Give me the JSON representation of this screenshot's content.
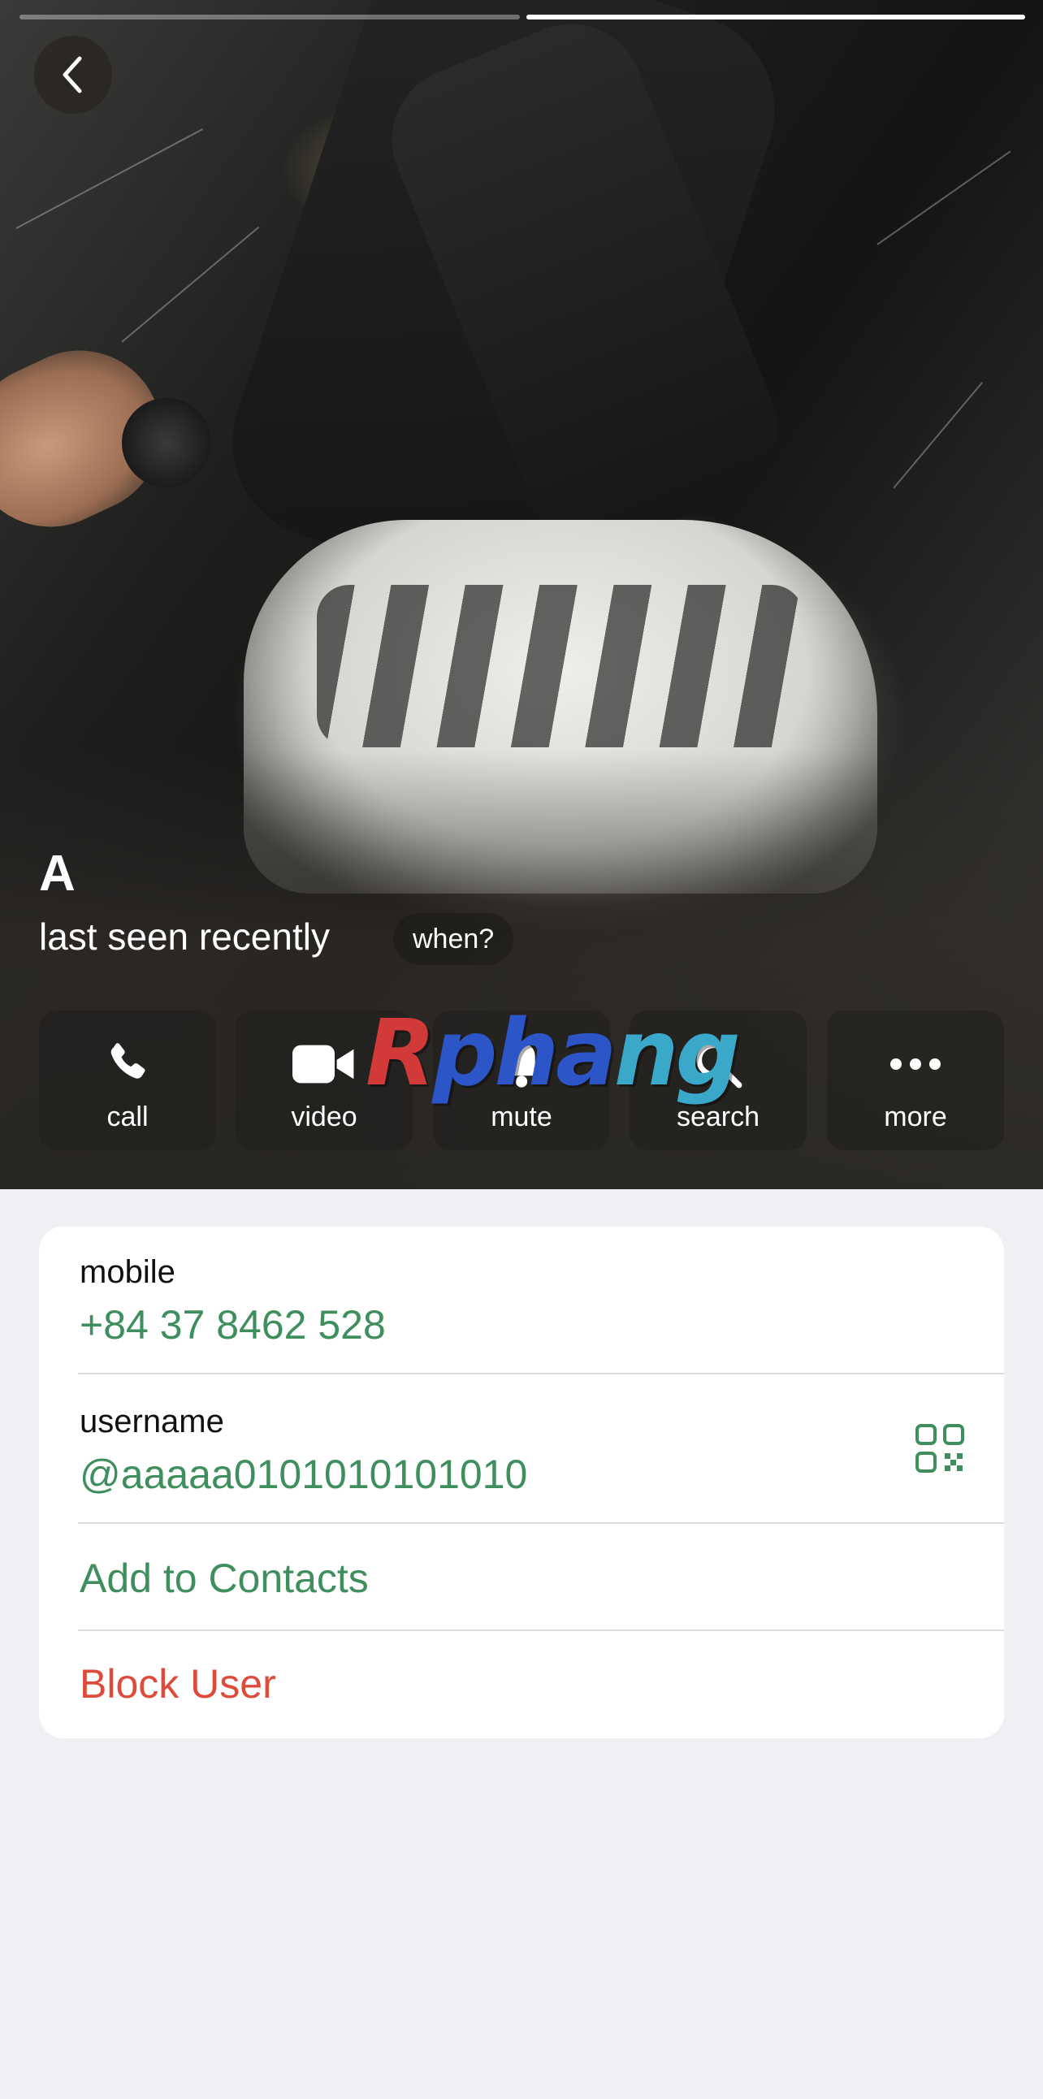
{
  "story_progress": {
    "segments": 2,
    "active_segment": 2
  },
  "header": {
    "back_icon": "chevron-left-icon"
  },
  "profile": {
    "name": "A",
    "status": "last seen recently",
    "when_chip": "when?"
  },
  "actions": [
    {
      "label": "call",
      "icon": "phone-icon"
    },
    {
      "label": "video",
      "icon": "video-camera-icon"
    },
    {
      "label": "mute",
      "icon": "bell-icon"
    },
    {
      "label": "search",
      "icon": "search-icon"
    },
    {
      "label": "more",
      "icon": "more-dots-icon"
    }
  ],
  "watermark": {
    "text": "Rphang"
  },
  "info": {
    "mobile_label": "mobile",
    "mobile_value": "+84 37 8462 528",
    "username_label": "username",
    "username_value": "@aaaaa0101010101010",
    "add_contact": "Add to Contacts",
    "block_user": "Block User"
  },
  "colors": {
    "accent_green": "#3f8f5e",
    "danger_red": "#de4b3b",
    "background": "#efeff4"
  }
}
